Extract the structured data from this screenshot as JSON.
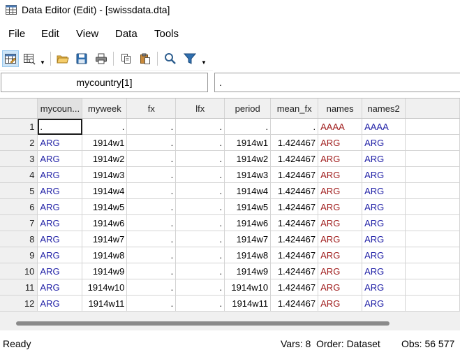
{
  "window": {
    "title": "Data Editor (Edit) - [swissdata.dta]"
  },
  "menu": [
    "File",
    "Edit",
    "View",
    "Data",
    "Tools"
  ],
  "toolbar": {
    "buttons": [
      "edit-mode-icon",
      "browse-mode-icon",
      "open-folder-icon",
      "save-icon",
      "print-icon",
      "copy-icon",
      "paste-icon",
      "search-icon",
      "filter-icon"
    ]
  },
  "namebox": {
    "value": "mycountry[1]"
  },
  "valuebox": {
    "value": "."
  },
  "grid": {
    "columns": [
      "mycoun...",
      "myweek",
      "fx",
      "lfx",
      "period",
      "mean_fx",
      "names",
      "names2"
    ],
    "rows": [
      [
        "1",
        ".",
        ".",
        ".",
        ".",
        ".",
        ".",
        "AAAA",
        "AAAA"
      ],
      [
        "2",
        "ARG",
        "1914w1",
        ".",
        ".",
        "1914w1",
        "1.424467",
        "ARG",
        "ARG"
      ],
      [
        "3",
        "ARG",
        "1914w2",
        ".",
        ".",
        "1914w2",
        "1.424467",
        "ARG",
        "ARG"
      ],
      [
        "4",
        "ARG",
        "1914w3",
        ".",
        ".",
        "1914w3",
        "1.424467",
        "ARG",
        "ARG"
      ],
      [
        "5",
        "ARG",
        "1914w4",
        ".",
        ".",
        "1914w4",
        "1.424467",
        "ARG",
        "ARG"
      ],
      [
        "6",
        "ARG",
        "1914w5",
        ".",
        ".",
        "1914w5",
        "1.424467",
        "ARG",
        "ARG"
      ],
      [
        "7",
        "ARG",
        "1914w6",
        ".",
        ".",
        "1914w6",
        "1.424467",
        "ARG",
        "ARG"
      ],
      [
        "8",
        "ARG",
        "1914w7",
        ".",
        ".",
        "1914w7",
        "1.424467",
        "ARG",
        "ARG"
      ],
      [
        "9",
        "ARG",
        "1914w8",
        ".",
        ".",
        "1914w8",
        "1.424467",
        "ARG",
        "ARG"
      ],
      [
        "10",
        "ARG",
        "1914w9",
        ".",
        ".",
        "1914w9",
        "1.424467",
        "ARG",
        "ARG"
      ],
      [
        "11",
        "ARG",
        "1914w10",
        ".",
        ".",
        "1914w10",
        "1.424467",
        "ARG",
        "ARG"
      ],
      [
        "12",
        "ARG",
        "1914w11",
        ".",
        ".",
        "1914w11",
        "1.424467",
        "ARG",
        "ARG"
      ]
    ]
  },
  "status": {
    "left": "Ready",
    "vars": "Vars: 8",
    "order": "Order: Dataset",
    "obs": "Obs: 56 577"
  },
  "colors": {
    "string_text": "#1f1fa6",
    "label_text": "#a01e1e",
    "selected_button": "#cce4f7"
  }
}
